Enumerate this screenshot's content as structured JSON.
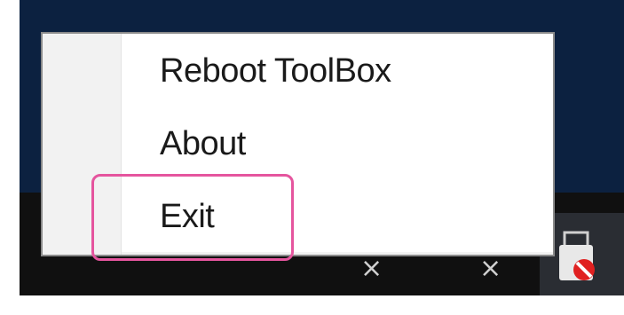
{
  "context_menu": {
    "items": [
      {
        "label": "Reboot ToolBox"
      },
      {
        "label": "About"
      },
      {
        "label": "Exit"
      }
    ]
  },
  "highlight_color": "#e5559e",
  "tray": {
    "icons": [
      "person-icon",
      "people-icon",
      "usb-drive-blocked-icon"
    ]
  }
}
